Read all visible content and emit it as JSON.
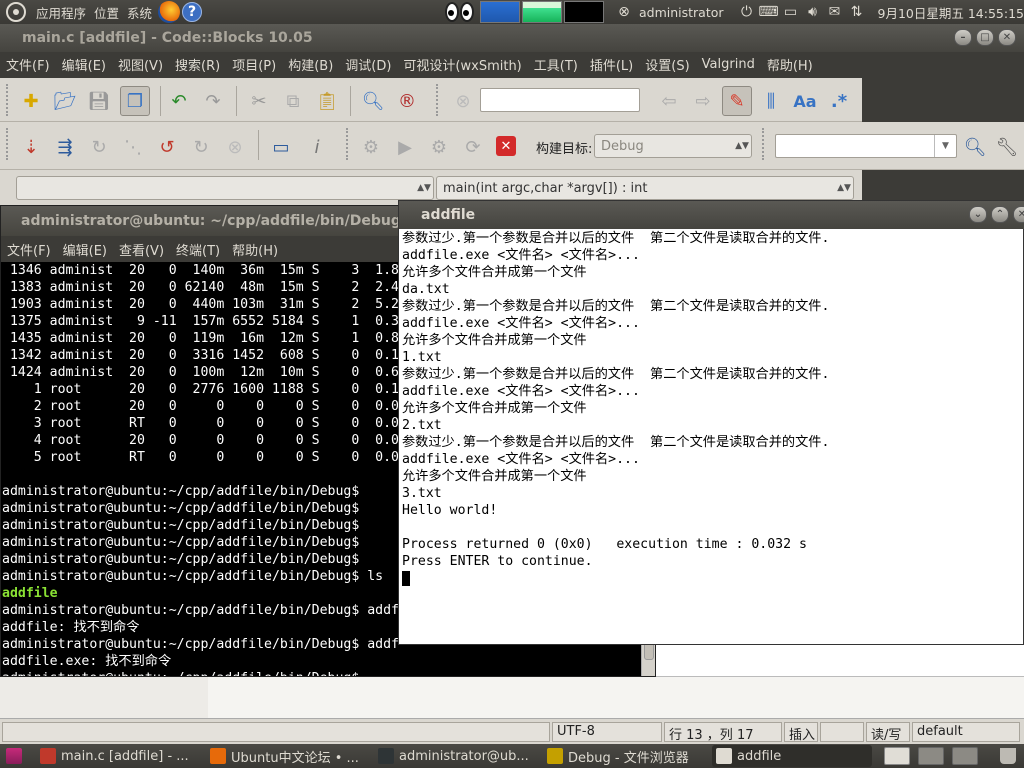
{
  "top_panel": {
    "applications": "应用程序",
    "places": "位置",
    "system": "系统",
    "user": "administrator",
    "datetime": "9月10日星期五 14:55:15"
  },
  "codeblocks": {
    "title": "main.c [addfile] - Code::Blocks 10.05",
    "menu": [
      "文件(F)",
      "编辑(E)",
      "视图(V)",
      "搜索(R)",
      "项目(P)",
      "构建(B)",
      "调试(D)",
      "可视设计(wxSmith)",
      "工具(T)",
      "插件(L)",
      "设置(S)",
      "Valgrind",
      "帮助(H)"
    ],
    "build_target_label": "构建目标:",
    "build_target_value": "Debug",
    "function_combo": "main(int argc,char *argv[]) : int",
    "status": {
      "encoding": "UTF-8",
      "position": "行 13 ，列 17",
      "insert_mode": "插入",
      "rw_mode": "读/写",
      "profile": "default"
    }
  },
  "terminal": {
    "title": "administrator@ubuntu: ~/cpp/addfile/bin/Debug",
    "menu": [
      "文件(F)",
      "编辑(E)",
      "查看(V)",
      "终端(T)",
      "帮助(H)"
    ],
    "lines": [
      {
        "text": " 1346 administ  20   0  140m  36m  15m S    3  1.8",
        "dir": false
      },
      {
        "text": " 1383 administ  20   0 62140  48m  15m S    2  2.4",
        "dir": false
      },
      {
        "text": " 1903 administ  20   0  440m 103m  31m S    2  5.2",
        "dir": false
      },
      {
        "text": " 1375 administ   9 -11  157m 6552 5184 S    1  0.3",
        "dir": false
      },
      {
        "text": " 1435 administ  20   0  119m  16m  12m S    1  0.8",
        "dir": false
      },
      {
        "text": " 1342 administ  20   0  3316 1452  608 S    0  0.1",
        "dir": false
      },
      {
        "text": " 1424 administ  20   0  100m  12m  10m S    0  0.6",
        "dir": false
      },
      {
        "text": "    1 root      20   0  2776 1600 1188 S    0  0.1",
        "dir": false
      },
      {
        "text": "    2 root      20   0     0    0    0 S    0  0.0",
        "dir": false
      },
      {
        "text": "    3 root      RT   0     0    0    0 S    0  0.0",
        "dir": false
      },
      {
        "text": "    4 root      20   0     0    0    0 S    0  0.0",
        "dir": false
      },
      {
        "text": "    5 root      RT   0     0    0    0 S    0  0.0",
        "dir": false
      },
      {
        "text": "",
        "dir": false
      },
      {
        "text": "administrator@ubuntu:~/cpp/addfile/bin/Debug$",
        "dir": false
      },
      {
        "text": "administrator@ubuntu:~/cpp/addfile/bin/Debug$",
        "dir": false
      },
      {
        "text": "administrator@ubuntu:~/cpp/addfile/bin/Debug$",
        "dir": false
      },
      {
        "text": "administrator@ubuntu:~/cpp/addfile/bin/Debug$",
        "dir": false
      },
      {
        "text": "administrator@ubuntu:~/cpp/addfile/bin/Debug$",
        "dir": false
      },
      {
        "text": "administrator@ubuntu:~/cpp/addfile/bin/Debug$ ls",
        "dir": false
      },
      {
        "text": "addfile",
        "dir": true
      },
      {
        "text": "administrator@ubuntu:~/cpp/addfile/bin/Debug$ addf",
        "dir": false
      },
      {
        "text": "addfile: 找不到命令",
        "dir": false
      },
      {
        "text": "administrator@ubuntu:~/cpp/addfile/bin/Debug$ addf",
        "dir": false
      },
      {
        "text": "addfile.exe: 找不到命令",
        "dir": false
      },
      {
        "text": "administrator@ubuntu:~/cpp/addfile/bin/Debug$ _",
        "dir": false
      }
    ]
  },
  "console": {
    "title": "addfile",
    "lines": [
      "参数过少.第一个参数是合并以后的文件  第二个文件是读取合并的文件.",
      "addfile.exe <文件名> <文件名>...",
      "允许多个文件合并成第一个文件",
      "da.txt",
      "参数过少.第一个参数是合并以后的文件  第二个文件是读取合并的文件.",
      "addfile.exe <文件名> <文件名>...",
      "允许多个文件合并成第一个文件",
      "1.txt",
      "参数过少.第一个参数是合并以后的文件  第二个文件是读取合并的文件.",
      "addfile.exe <文件名> <文件名>...",
      "允许多个文件合并成第一个文件",
      "2.txt",
      "参数过少.第一个参数是合并以后的文件  第二个文件是读取合并的文件.",
      "addfile.exe <文件名> <文件名>...",
      "允许多个文件合并成第一个文件",
      "3.txt",
      "Hello world!",
      "",
      "Process returned 0 (0x0)   execution time : 0.032 s",
      "Press ENTER to continue."
    ]
  },
  "taskbar": [
    {
      "label": "main.c [addfile] - ...",
      "icon_color": "#c0392b",
      "icon": "codeblocks-icon"
    },
    {
      "label": "Ubuntu中文论坛 • ...",
      "icon_color": "#e76a0a",
      "icon": "firefox-icon"
    },
    {
      "label": "administrator@ub...",
      "icon_color": "#2e3436",
      "icon": "terminal-icon"
    },
    {
      "label": "Debug - 文件浏览器",
      "icon_color": "#c4a000",
      "icon": "folder-icon"
    },
    {
      "label": "addfile",
      "icon_color": "#dfdbd2",
      "icon": "window-icon"
    }
  ]
}
